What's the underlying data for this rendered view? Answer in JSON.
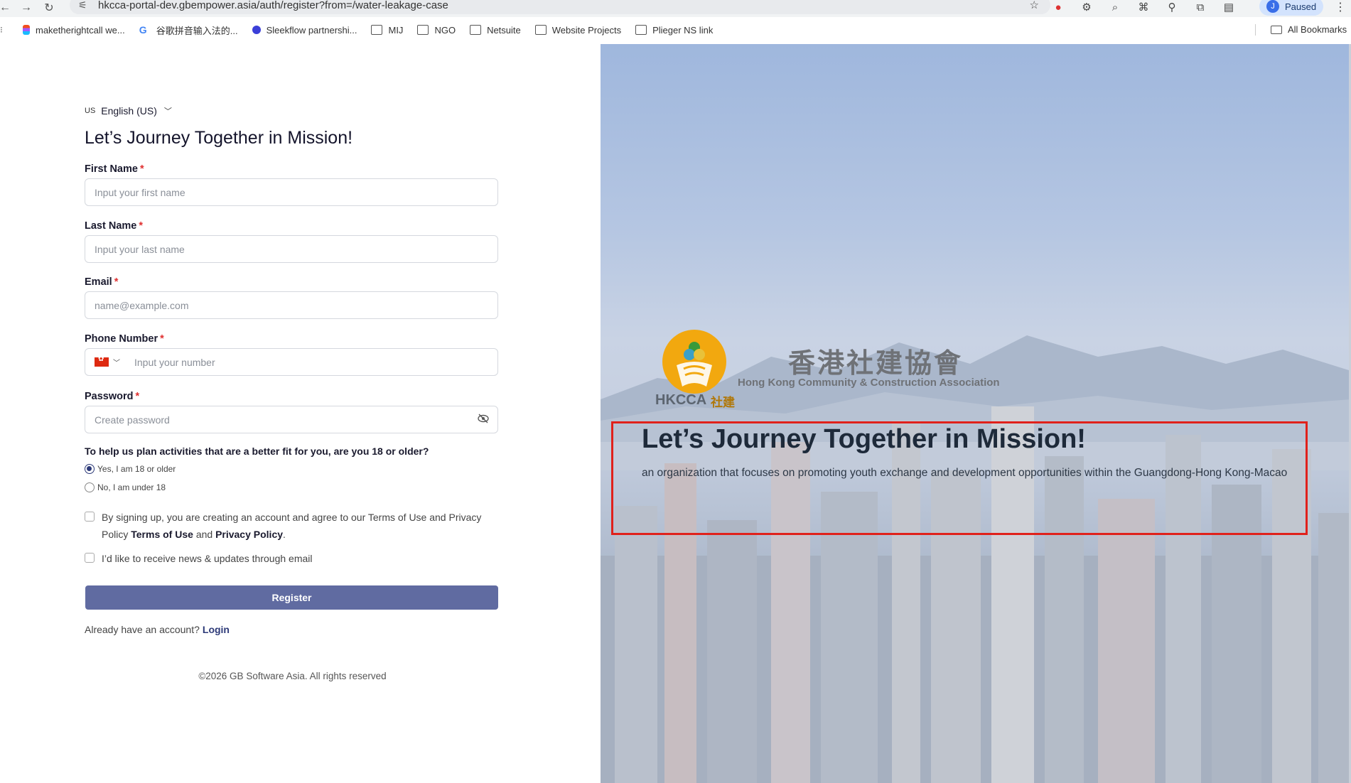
{
  "browser": {
    "url": "hkcca-portal-dev.gbempower.asia/auth/register?from=/water-leakage-case",
    "profile_initial": "J",
    "profile_status": "Paused",
    "bookmarks": [
      {
        "label": "maketherightcall we...",
        "icon": "figma-icon"
      },
      {
        "label": "谷歌拼音输入法的...",
        "icon": "google-icon"
      },
      {
        "label": "Sleekflow partnershi...",
        "icon": "sleekflow-icon"
      },
      {
        "label": "MIJ",
        "icon": "folder-icon"
      },
      {
        "label": "NGO",
        "icon": "folder-icon"
      },
      {
        "label": "Netsuite",
        "icon": "folder-icon"
      },
      {
        "label": "Website Projects",
        "icon": "folder-icon"
      },
      {
        "label": "Plieger NS link",
        "icon": "folder-icon"
      }
    ],
    "all_bookmarks": "All Bookmarks"
  },
  "form": {
    "lang_code": "US",
    "lang_label": "English (US)",
    "title": "Let’s Journey Together in Mission!",
    "first_name": {
      "label": "First Name",
      "placeholder": "Input your first name"
    },
    "last_name": {
      "label": "Last Name",
      "placeholder": "Input your last name"
    },
    "email": {
      "label": "Email",
      "placeholder": "name@example.com"
    },
    "phone": {
      "label": "Phone Number",
      "placeholder": "Input your number"
    },
    "password": {
      "label": "Password",
      "placeholder": "Create password"
    },
    "required_mark": "*",
    "age_question": "To help us plan activities that are a better fit for you, are you 18 or older?",
    "age_yes": "Yes, I am 18 or older",
    "age_no": "No, I am under 18",
    "terms_prefix": "By signing up, you are creating an account and agree to our Terms of Use and Privacy Policy",
    "terms_link": "Terms of Use",
    "terms_and": "and",
    "privacy_link": "Privacy Policy",
    "terms_end": ".",
    "news_label": "I’d like to receive news & updates through email",
    "register_label": "Register",
    "already_text": "Already have an account?",
    "login_label": "Login",
    "copyright": "©2026 GB Software Asia. All rights reserved"
  },
  "hero": {
    "logo_text": "HKCCA",
    "logo_cn_short": "社建",
    "org_cn": "香港社建協會",
    "org_en": "Hong Kong Community & Construction Association",
    "title": "Let’s Journey Together in Mission!",
    "subtitle": "an organization that focuses on promoting youth exchange and development opportunities within the Guangdong-Hong Kong-Macao",
    "highlight_color": "#e0211b"
  },
  "colors": {
    "primary_button": "#606ba1",
    "required": "#e03131",
    "logo_orange": "#f2a80f"
  }
}
